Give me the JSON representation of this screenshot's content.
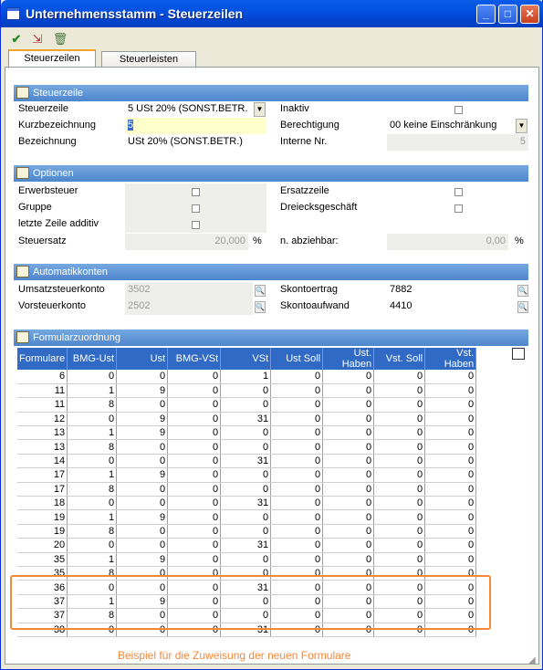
{
  "window": {
    "title": "Unternehmensstamm - Steuerzeilen"
  },
  "toolbar": {
    "check_icon": "✔",
    "exit_icon": "⇲",
    "delete_icon": "🗑"
  },
  "tabs": [
    {
      "label": "Steuerzeilen"
    },
    {
      "label": "Steuerleisten"
    }
  ],
  "steuerzeile": {
    "heading": "Steuerzeile",
    "steuerzeile_label": "Steuerzeile",
    "steuerzeile_value": "5   USt 20% (SONST.BETR.",
    "kurz_label": "Kurzbezeichnung",
    "kurz_value": "5",
    "bez_label": "Bezeichnung",
    "bez_value": "USt 20% (SONST.BETR.)",
    "inaktiv_label": "Inaktiv",
    "berechtigung_label": "Berechtigung",
    "berechtigung_value": "00 keine Einschränkung",
    "interne_label": "Interne Nr.",
    "interne_value": "5"
  },
  "optionen": {
    "heading": "Optionen",
    "erwerb_label": "Erwerbsteuer",
    "gruppe_label": "Gruppe",
    "letzte_label": "letzte Zeile additiv",
    "satz_label": "Steuersatz",
    "satz_value": "20,000",
    "satz_unit": "%",
    "ersatz_label": "Ersatzzeile",
    "dreieck_label": "Dreiecksgeschäft",
    "abz_label": "n. abziehbar:",
    "abz_value": "0,00",
    "abz_unit": "%"
  },
  "konten": {
    "heading": "Automatikkonten",
    "ust_label": "Umsatzsteuerkonto",
    "ust_value": "3502",
    "vst_label": "Vorsteuerkonto",
    "vst_value": "2502",
    "skerl_label": "Skontoertrag",
    "skerl_value": "7882",
    "skauf_label": "Skontoaufwand",
    "skauf_value": "4410"
  },
  "formular": {
    "heading": "Formularzuordnung",
    "columns": [
      "Formulare",
      "BMG-Ust",
      "Ust",
      "BMG-VSt",
      "VSt",
      "Ust Soll",
      "Ust. Haben",
      "Vst. Soll",
      "Vst. Haben"
    ],
    "rows": [
      [
        "6",
        "0",
        "0",
        "0",
        "1",
        "0",
        "0",
        "0",
        "0"
      ],
      [
        "11",
        "1",
        "9",
        "0",
        "0",
        "0",
        "0",
        "0",
        "0"
      ],
      [
        "11",
        "8",
        "0",
        "0",
        "0",
        "0",
        "0",
        "0",
        "0"
      ],
      [
        "12",
        "0",
        "9",
        "0",
        "31",
        "0",
        "0",
        "0",
        "0"
      ],
      [
        "13",
        "1",
        "9",
        "0",
        "0",
        "0",
        "0",
        "0",
        "0"
      ],
      [
        "13",
        "8",
        "0",
        "0",
        "0",
        "0",
        "0",
        "0",
        "0"
      ],
      [
        "14",
        "0",
        "0",
        "0",
        "31",
        "0",
        "0",
        "0",
        "0"
      ],
      [
        "17",
        "1",
        "9",
        "0",
        "0",
        "0",
        "0",
        "0",
        "0"
      ],
      [
        "17",
        "8",
        "0",
        "0",
        "0",
        "0",
        "0",
        "0",
        "0"
      ],
      [
        "18",
        "0",
        "0",
        "0",
        "31",
        "0",
        "0",
        "0",
        "0"
      ],
      [
        "19",
        "1",
        "9",
        "0",
        "0",
        "0",
        "0",
        "0",
        "0"
      ],
      [
        "19",
        "8",
        "0",
        "0",
        "0",
        "0",
        "0",
        "0",
        "0"
      ],
      [
        "20",
        "0",
        "0",
        "0",
        "31",
        "0",
        "0",
        "0",
        "0"
      ],
      [
        "35",
        "1",
        "9",
        "0",
        "0",
        "0",
        "0",
        "0",
        "0"
      ],
      [
        "35",
        "8",
        "0",
        "0",
        "0",
        "0",
        "0",
        "0",
        "0"
      ],
      [
        "36",
        "0",
        "0",
        "0",
        "31",
        "0",
        "0",
        "0",
        "0"
      ],
      [
        "37",
        "1",
        "9",
        "0",
        "0",
        "0",
        "0",
        "0",
        "0"
      ],
      [
        "37",
        "8",
        "0",
        "0",
        "0",
        "0",
        "0",
        "0",
        "0"
      ],
      [
        "38",
        "0",
        "0",
        "0",
        "31",
        "0",
        "0",
        "0",
        "0"
      ]
    ]
  },
  "caption": "Beispiel für die Zuweisung der neuen Formulare"
}
